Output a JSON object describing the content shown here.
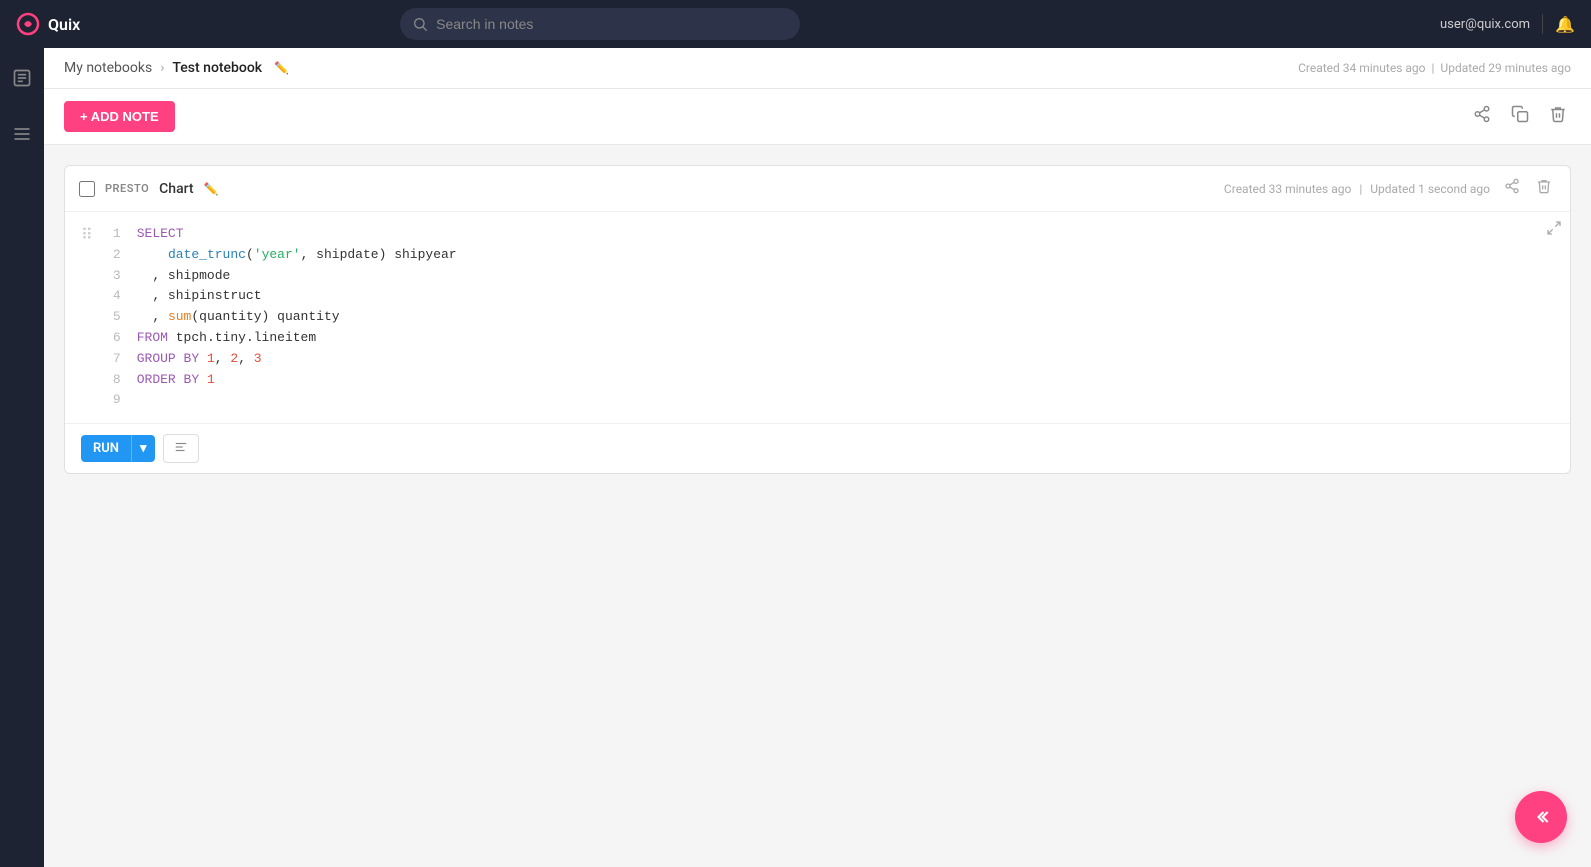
{
  "app": {
    "brand": "Quix"
  },
  "navbar": {
    "user_email": "user@quix.com",
    "search_placeholder": "Search in notes"
  },
  "sidebar": {
    "items": [
      {
        "icon": "📄",
        "name": "notes-icon"
      },
      {
        "icon": "☰",
        "name": "menu-icon"
      }
    ]
  },
  "breadcrumb": {
    "parent": "My notebooks",
    "separator": "›",
    "current": "Test notebook"
  },
  "header_meta": {
    "created": "Created 34 minutes ago",
    "separator": "|",
    "updated": "Updated 29 minutes ago"
  },
  "toolbar": {
    "add_note_label": "+ ADD NOTE"
  },
  "note": {
    "engine": "PRESTO",
    "title": "Chart",
    "header_meta": {
      "created": "Created 33 minutes ago",
      "separator": "|",
      "updated": "Updated 1 second ago"
    },
    "code_lines": [
      {
        "num": "1",
        "content": "SELECT",
        "parts": [
          {
            "text": "SELECT",
            "cls": "kw"
          }
        ]
      },
      {
        "num": "2",
        "content": "    date_trunc('year', shipdate) shipyear",
        "parts": [
          {
            "text": "    "
          },
          {
            "text": "date_trunc",
            "cls": "fn"
          },
          {
            "text": "("
          },
          {
            "text": "'year'",
            "cls": "str"
          },
          {
            "text": ", shipdate) shipyear"
          }
        ]
      },
      {
        "num": "3",
        "content": "  , shipmode",
        "parts": [
          {
            "text": "  , shipmode"
          }
        ]
      },
      {
        "num": "4",
        "content": "  , shipinstruct",
        "parts": [
          {
            "text": "  , shipinstruct"
          }
        ]
      },
      {
        "num": "5",
        "content": "  , sum(quantity) quantity",
        "parts": [
          {
            "text": "  , "
          },
          {
            "text": "sum",
            "cls": "fn"
          },
          {
            "text": "(quantity) quantity"
          }
        ]
      },
      {
        "num": "6",
        "content": "FROM tpch.tiny.lineitem",
        "parts": [
          {
            "text": "FROM ",
            "cls": "kw"
          },
          {
            "text": "tpch.tiny.lineitem"
          }
        ]
      },
      {
        "num": "7",
        "content": "GROUP BY 1, 2, 3",
        "parts": [
          {
            "text": "GROUP BY ",
            "cls": "kw"
          },
          {
            "text": "1"
          },
          {
            "text": ", "
          },
          {
            "text": "2"
          },
          {
            "text": ", "
          },
          {
            "text": "3"
          }
        ]
      },
      {
        "num": "8",
        "content": "ORDER BY 1",
        "parts": [
          {
            "text": "ORDER BY ",
            "cls": "kw"
          },
          {
            "text": "1"
          }
        ]
      },
      {
        "num": "9",
        "content": "",
        "parts": []
      }
    ],
    "run_btn": "RUN",
    "format_btn_title": "Format"
  }
}
